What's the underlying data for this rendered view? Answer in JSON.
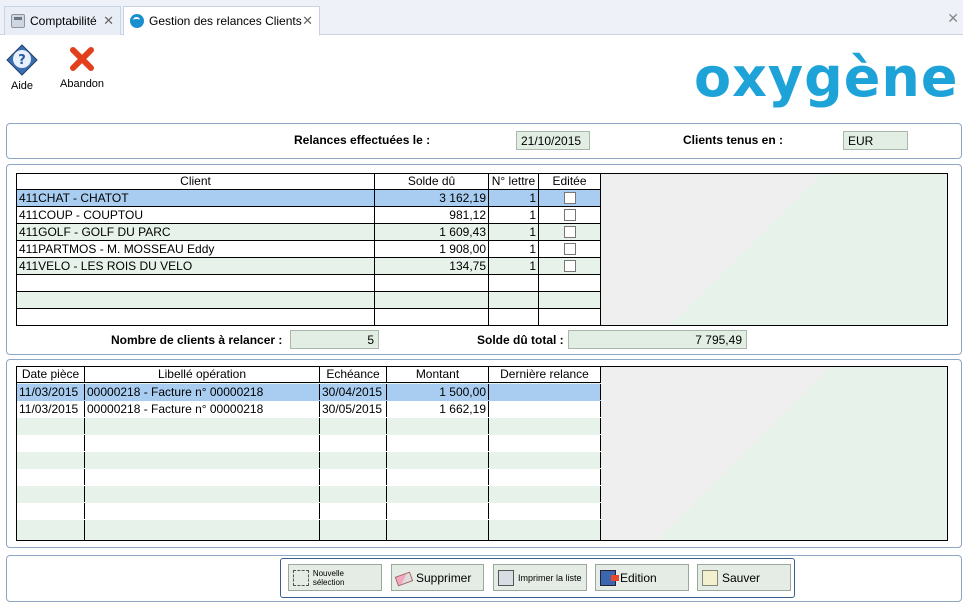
{
  "tabs": [
    {
      "label": "Comptabilité",
      "active": false
    },
    {
      "label": "Gestion des relances Clients",
      "active": true
    }
  ],
  "toolbar": {
    "help_label": "Aide",
    "abandon_label": "Abandon"
  },
  "logo": {
    "text": "oxygène",
    "color": "#1ea3d9"
  },
  "header": {
    "relances_label": "Relances effectuées le :",
    "relances_date": "21/10/2015",
    "currency_label": "Clients tenus en :",
    "currency_value": "EUR"
  },
  "clients_table": {
    "headers": [
      "Client",
      "Solde dû",
      "N° lettre",
      "Editée"
    ],
    "rows": [
      {
        "client": "411CHAT - CHATOT",
        "solde": "3 162,19",
        "lettre": "1",
        "editee": false
      },
      {
        "client": "411COUP - COUPTOU",
        "solde": "981,12",
        "lettre": "1",
        "editee": false
      },
      {
        "client": "411GOLF - GOLF DU PARC",
        "solde": "1 609,43",
        "lettre": "1",
        "editee": false
      },
      {
        "client": "411PARTMOS - M. MOSSEAU Eddy",
        "solde": "1 908,00",
        "lettre": "1",
        "editee": false
      },
      {
        "client": "411VELO - LES ROIS DU VELO",
        "solde": "134,75",
        "lettre": "1",
        "editee": false
      }
    ]
  },
  "summary": {
    "count_label": "Nombre de clients à relancer :",
    "count_value": "5",
    "total_label": "Solde dû total :",
    "total_value": "7 795,49"
  },
  "pieces_table": {
    "headers": [
      "Date pièce",
      "Libellé opération",
      "Echéance",
      "Montant",
      "Dernière relance"
    ],
    "rows": [
      {
        "date": "11/03/2015",
        "libelle": "00000218 - Facture n° 00000218",
        "echeance": "30/04/2015",
        "montant": "1 500,00",
        "relance": ""
      },
      {
        "date": "11/03/2015",
        "libelle": "00000218 - Facture n° 00000218",
        "echeance": "30/05/2015",
        "montant": "1 662,19",
        "relance": ""
      }
    ]
  },
  "buttons": {
    "new_selection": "Nouvelle sélection",
    "delete": "Supprimer",
    "print_list": "Imprimer la liste",
    "edition": "Edition",
    "save": "Sauver"
  },
  "colors": {
    "selected_row": "#a8cdf0",
    "alt_row": "#e7f2ea",
    "value_box": "#e2eee4",
    "panel_border": "#8fa6c3"
  }
}
